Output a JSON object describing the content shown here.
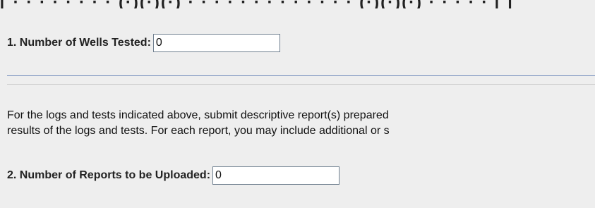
{
  "form": {
    "top_cutoff_text": "[ · · · · · · · · (·)(·)(·) · · · · · · · · · · · · · (·)(·)(·) · · · · · [ [",
    "q1": {
      "label": "1. Number of Wells Tested:",
      "value": "0"
    },
    "instructions": {
      "line1": "For the logs and tests indicated above, submit descriptive report(s) prepared",
      "line2": "results of the logs and tests. For each report, you may include additional or s"
    },
    "q2": {
      "label": "2. Number of Reports to be Uploaded:",
      "value": "0"
    }
  }
}
